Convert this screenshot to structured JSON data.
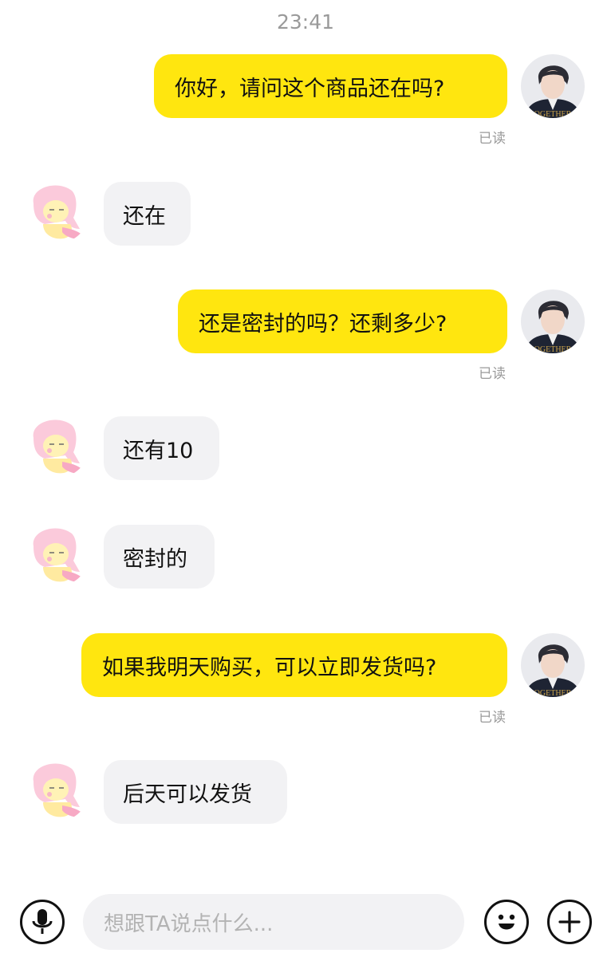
{
  "header": {
    "time": "23:41"
  },
  "messages": [
    {
      "direction": "out",
      "text": "你好，请问这个商品还在吗?",
      "status": "已读"
    },
    {
      "direction": "in",
      "text": "还在"
    },
    {
      "direction": "out",
      "text": "还是密封的吗？还剩多少?",
      "status": "已读"
    },
    {
      "direction": "in",
      "text": "还有10"
    },
    {
      "direction": "in",
      "text": "密封的"
    },
    {
      "direction": "out",
      "text": "如果我明天购买，可以立即发货吗?",
      "status": "已读"
    },
    {
      "direction": "in",
      "text": "后天可以发货"
    }
  ],
  "input": {
    "placeholder": "想跟TA说点什么..."
  },
  "icons": {
    "voice": "microphone-icon",
    "emoji": "emoji-icon",
    "more": "plus-icon"
  },
  "colors": {
    "outgoing_bubble": "#ffe60f",
    "incoming_bubble": "#f2f2f4",
    "placeholder_text": "#b3b3b3",
    "meta_text": "#9a9a9a"
  }
}
